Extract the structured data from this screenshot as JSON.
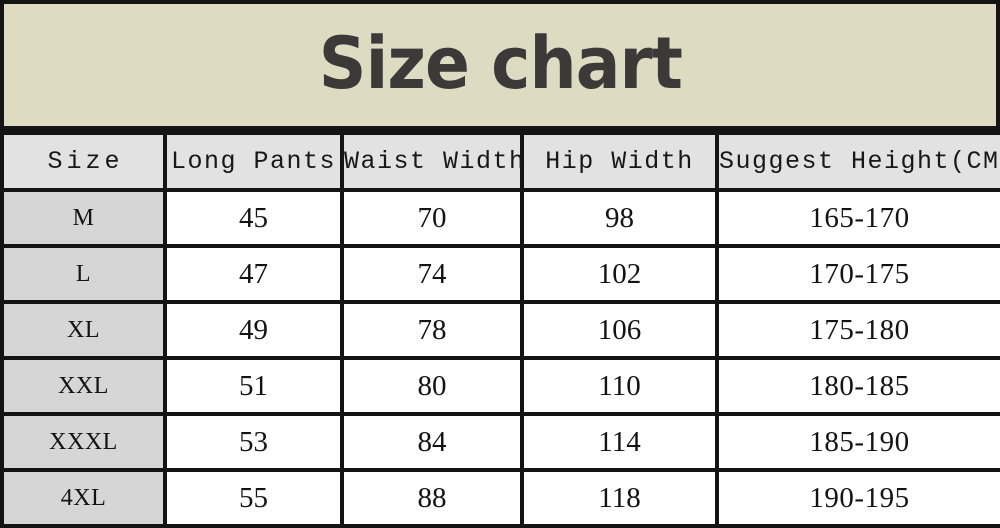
{
  "title": "Size chart",
  "colors": {
    "title_background": "#dedbc3",
    "title_text": "#3b3a38",
    "border": "#141414",
    "header_background": "#e2e2e2",
    "size_column_background": "#d6d6d6",
    "cell_background": "#ffffff",
    "cell_text": "#131313"
  },
  "table": {
    "columns": [
      {
        "key": "size",
        "label": "Size"
      },
      {
        "key": "pants",
        "label": "Long Pants"
      },
      {
        "key": "waist",
        "label": "Waist Width"
      },
      {
        "key": "hip",
        "label": "Hip Width"
      },
      {
        "key": "height",
        "label": "Suggest Height(CM)"
      }
    ],
    "rows": [
      {
        "size": "M",
        "pants": "45",
        "waist": "70",
        "hip": "98",
        "height": "165-170"
      },
      {
        "size": "L",
        "pants": "47",
        "waist": "74",
        "hip": "102",
        "height": "170-175"
      },
      {
        "size": "XL",
        "pants": "49",
        "waist": "78",
        "hip": "106",
        "height": "175-180"
      },
      {
        "size": "XXL",
        "pants": "51",
        "waist": "80",
        "hip": "110",
        "height": "180-185"
      },
      {
        "size": "XXXL",
        "pants": "53",
        "waist": "84",
        "hip": "114",
        "height": "185-190"
      },
      {
        "size": "4XL",
        "pants": "55",
        "waist": "88",
        "hip": "118",
        "height": "190-195"
      }
    ]
  }
}
